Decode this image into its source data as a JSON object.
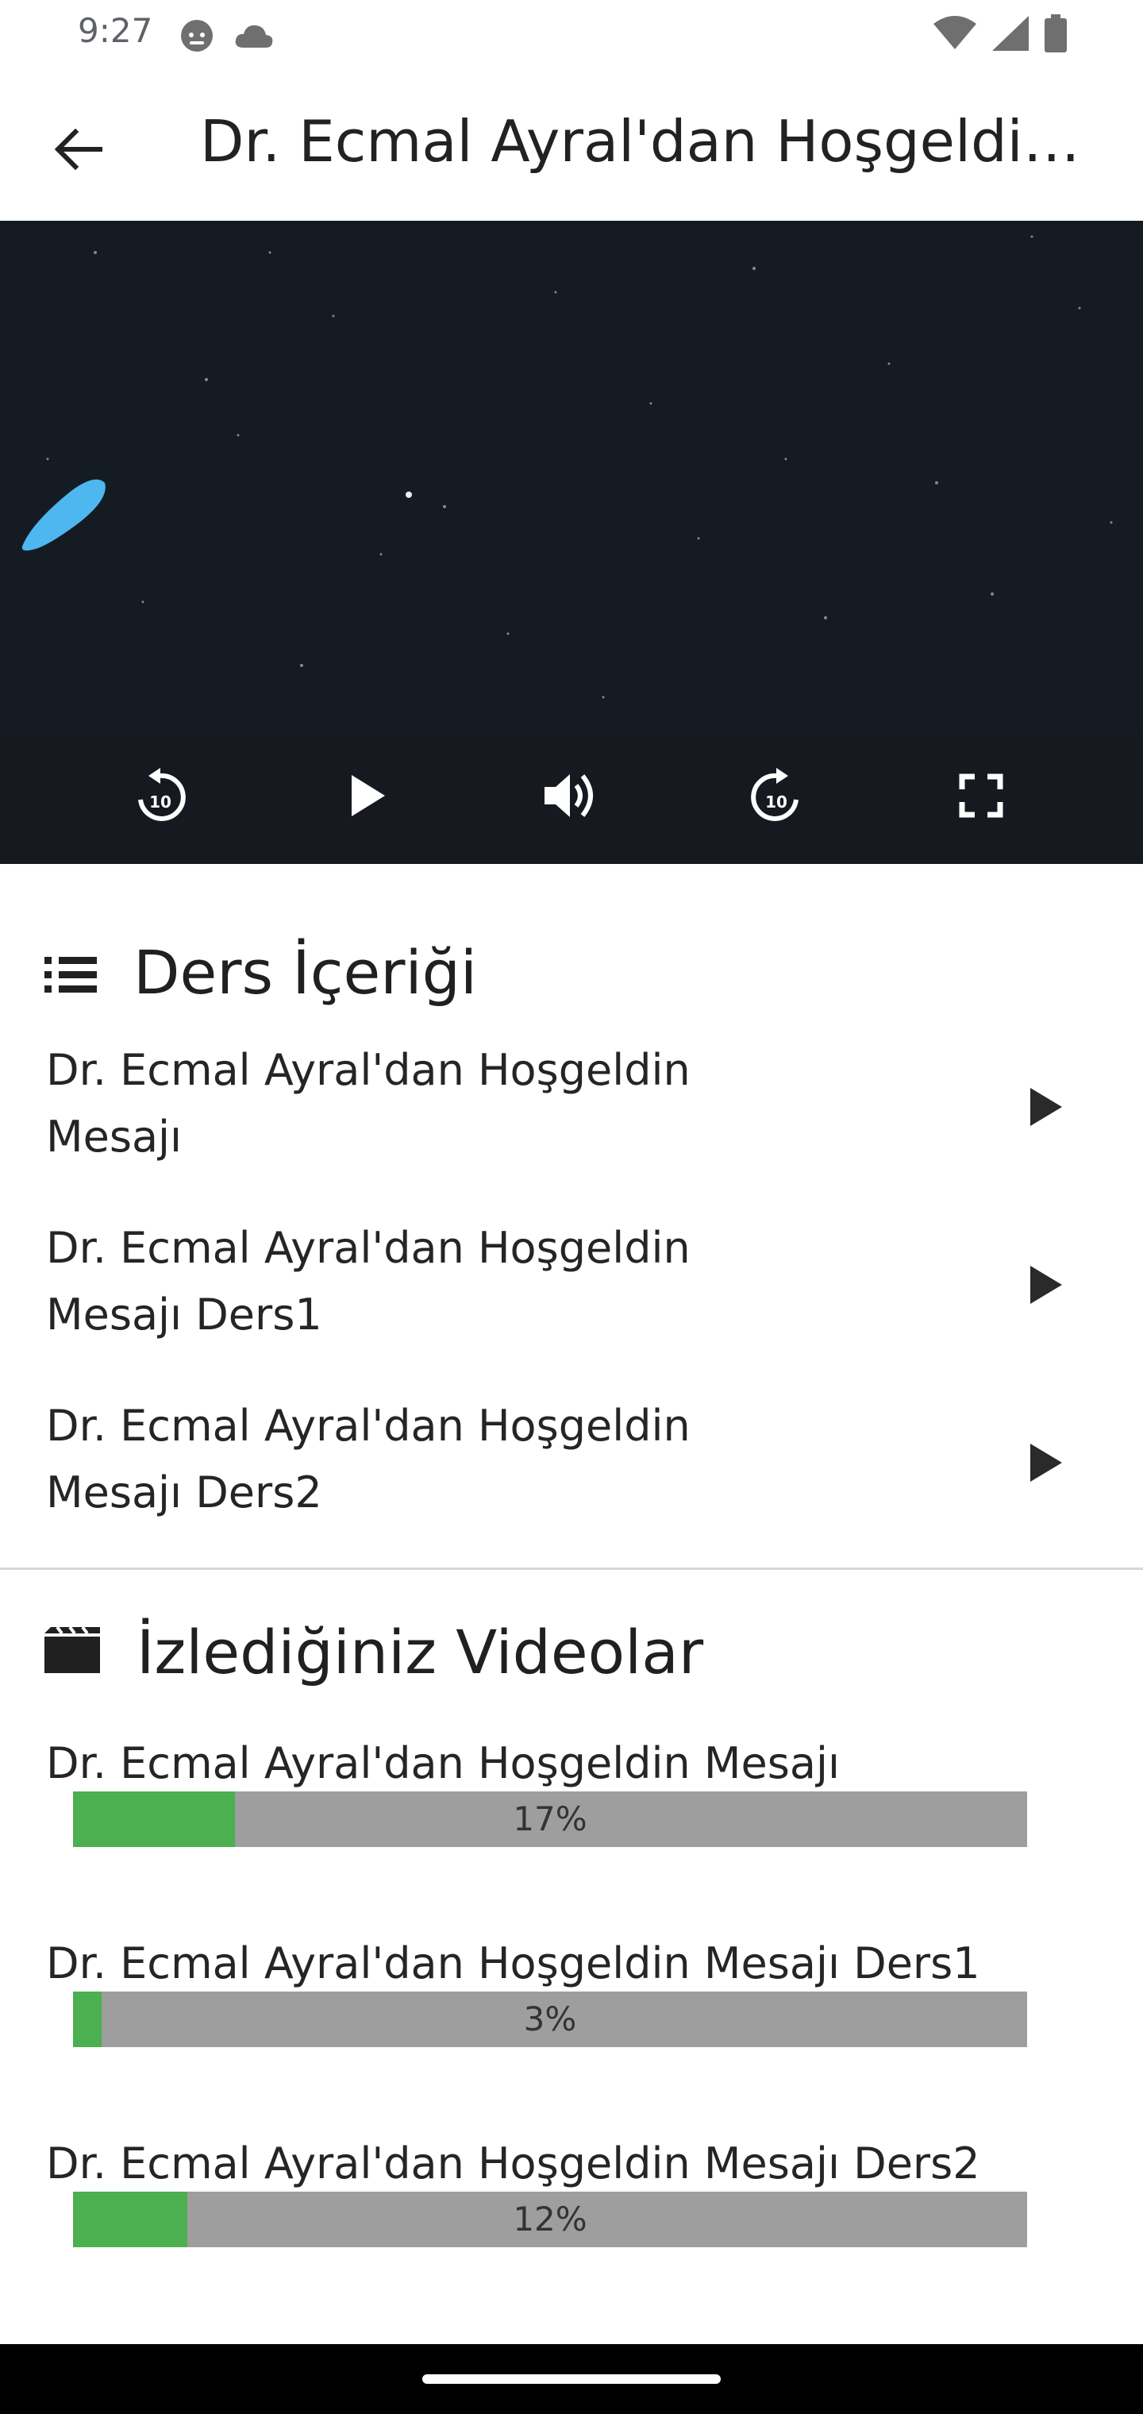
{
  "status_bar": {
    "time": "9:27"
  },
  "app_bar": {
    "title": "Dr. Ecmal Ayral'dan Hoşgeldin Mesajı"
  },
  "course_content": {
    "heading": "Ders İçeriği",
    "items": [
      {
        "label": "Dr. Ecmal Ayral'dan Hoşgeldin Mesajı"
      },
      {
        "label": "Dr. Ecmal Ayral'dan Hoşgeldin Mesajı Ders1"
      },
      {
        "label": "Dr. Ecmal Ayral'dan Hoşgeldin Mesajı Ders2"
      }
    ]
  },
  "watched_videos": {
    "heading": "İzlediğiniz Videolar",
    "items": [
      {
        "title": "Dr. Ecmal Ayral'dan Hoşgeldin Mesajı",
        "progress_label": "17%",
        "progress": 0.17
      },
      {
        "title": "Dr. Ecmal Ayral'dan Hoşgeldin Mesajı Ders1",
        "progress_label": "3%",
        "progress": 0.03
      },
      {
        "title": "Dr. Ecmal Ayral'dan Hoşgeldin Mesajı Ders2",
        "progress_label": "12%",
        "progress": 0.12
      }
    ]
  },
  "colors": {
    "progress_fill": "#4caf50",
    "progress_track": "#9e9e9e",
    "video_bg": "#151b23"
  }
}
